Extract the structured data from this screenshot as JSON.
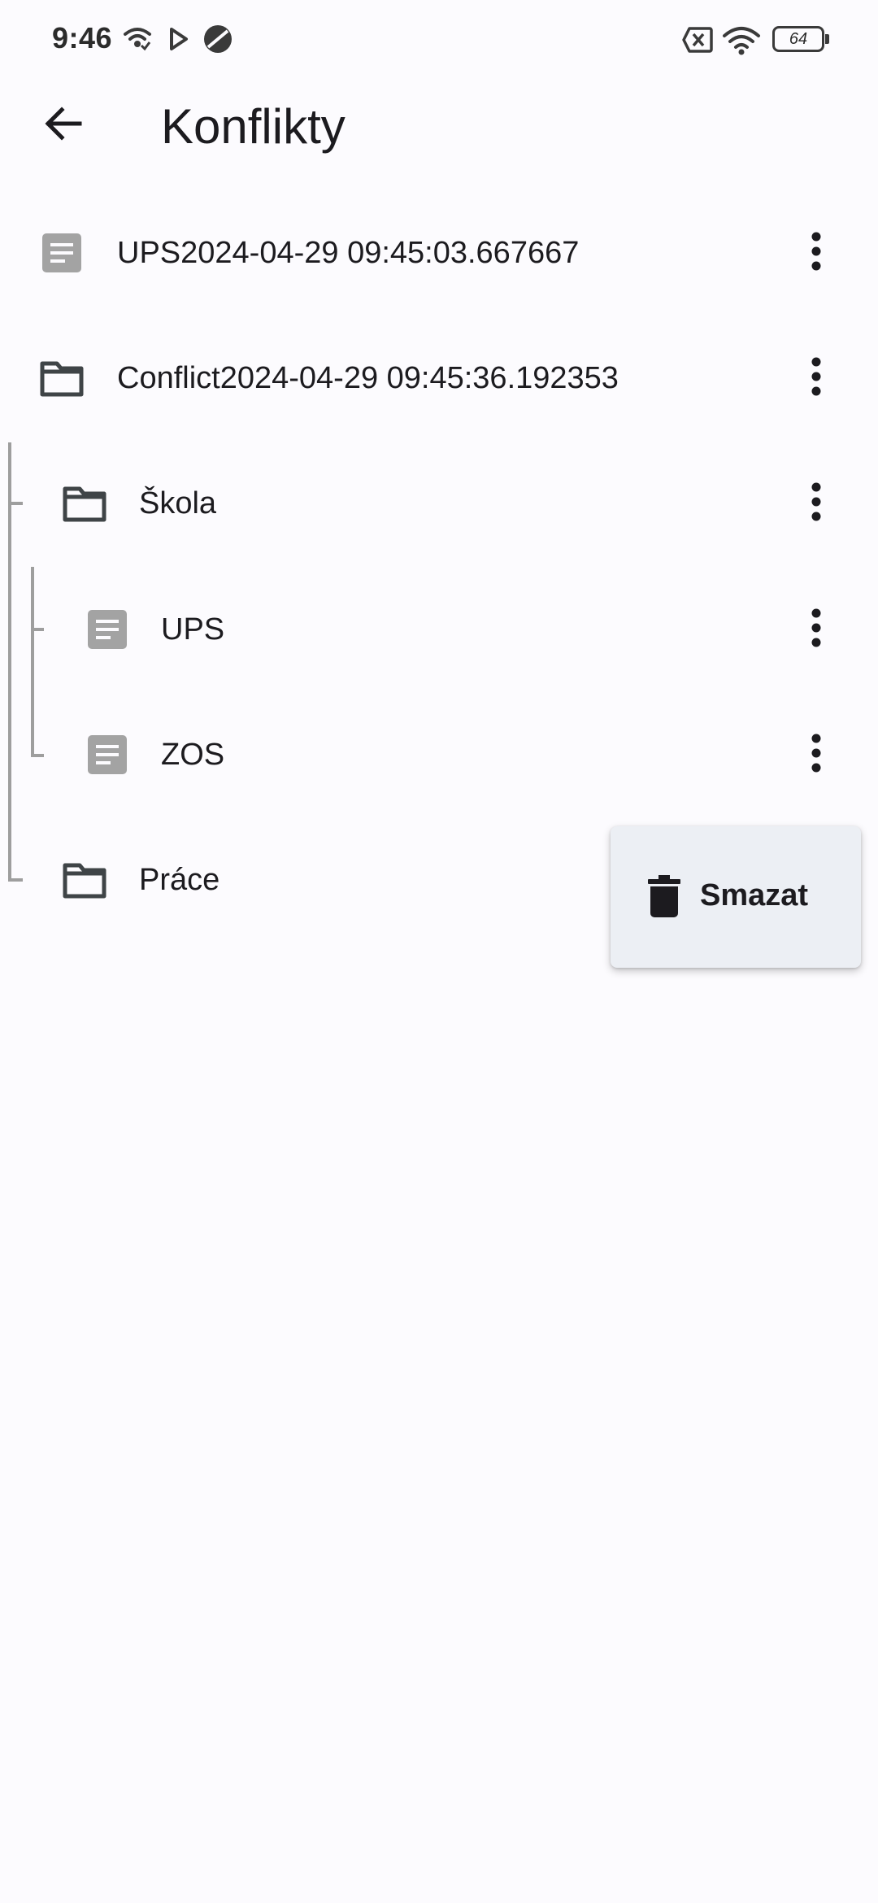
{
  "status_bar": {
    "time": "9:46",
    "icons": [
      "hotspot-icon",
      "play-store-icon",
      "vpn-icon",
      "no-sim-icon",
      "wifi-icon"
    ],
    "battery_level": "64"
  },
  "app_bar": {
    "back_icon": "arrow-left-icon",
    "title": "Konflikty"
  },
  "tree": [
    {
      "type": "file",
      "label": "UPS2024-04-29 09:45:03.667667",
      "depth": 0
    },
    {
      "type": "folder",
      "label": "Conflict2024-04-29 09:45:36.192353",
      "depth": 0
    },
    {
      "type": "folder",
      "label": "Škola",
      "depth": 1
    },
    {
      "type": "file",
      "label": "UPS",
      "depth": 2
    },
    {
      "type": "file",
      "label": "ZOS",
      "depth": 2
    },
    {
      "type": "folder",
      "label": "Práce",
      "depth": 1
    }
  ],
  "popup_menu": {
    "items": [
      {
        "icon": "trash-icon",
        "label": "Smazat"
      }
    ]
  },
  "colors": {
    "background": "#fcfbfe",
    "file_icon": "#a3a3a3",
    "folder_icon": "#3f4447",
    "tree_lines": "#9e9e9e",
    "menu_background": "#eceff4"
  }
}
